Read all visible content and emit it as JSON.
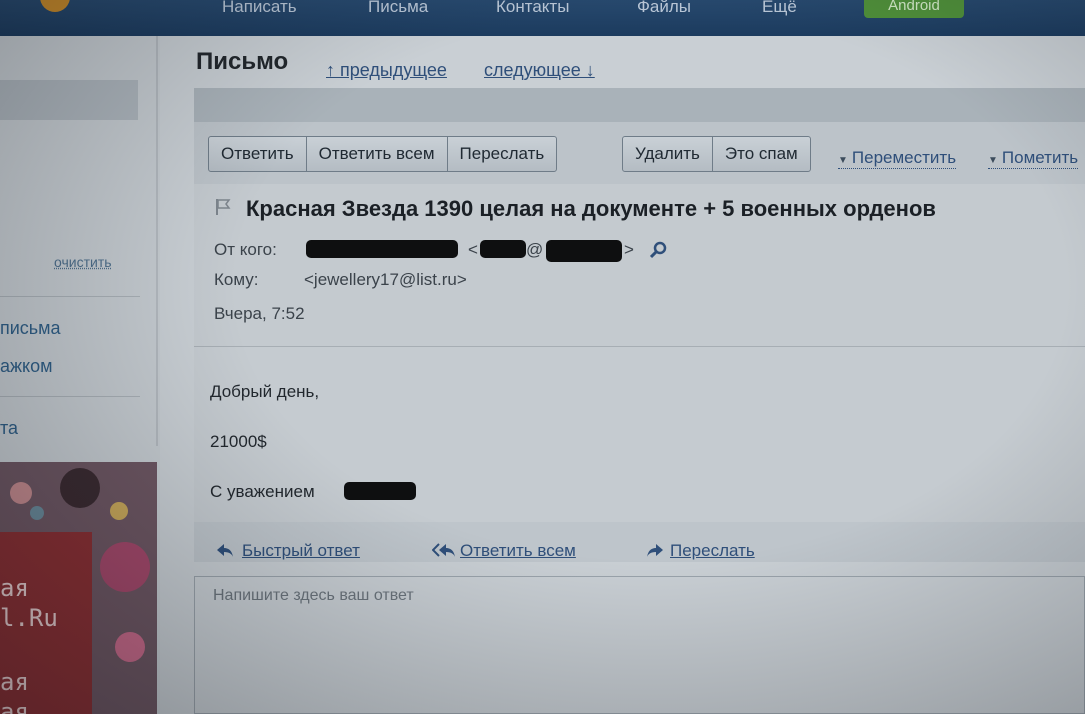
{
  "nav": {
    "items": [
      "Написать",
      "Письма",
      "Контакты",
      "Файлы",
      "Ещё"
    ],
    "android_label": "Android"
  },
  "sidebar": {
    "clear_label": "очистить",
    "links": [
      "письма",
      "ажком",
      "та"
    ],
    "ad_text": [
      "ая",
      "l.Ru",
      "ая",
      "ая"
    ]
  },
  "message": {
    "page_title": "Письмо",
    "prev_label": "↑ предыдущее",
    "next_label": "следующее ↓",
    "toolbar": {
      "reply": "Ответить",
      "reply_all": "Ответить всем",
      "forward": "Переслать",
      "delete": "Удалить",
      "spam": "Это спам",
      "move": "Переместить",
      "mark": "Пометить"
    },
    "subject": "Красная Звезда 1390 целая на документе + 5 военных орденов",
    "from_label": "От кого:",
    "from_bracket_open": "<",
    "from_at": "@",
    "from_bracket_close": ">",
    "to_label": "Кому:",
    "to_value": "<jewellery17@list.ru>",
    "date": "Вчера, 7:52",
    "body": {
      "greeting": "Добрый день,",
      "price": "21000$",
      "signoff": "С уважением"
    }
  },
  "quick_reply": {
    "quick_label": "Быстрый ответ",
    "reply_all_label": "Ответить всем",
    "forward_label": "Переслать",
    "placeholder": "Напишите здесь ваш ответ"
  },
  "colors": {
    "link": "#2f4f7a",
    "nav_bg": "#1c3b5e",
    "android": "#4f8f3a"
  }
}
